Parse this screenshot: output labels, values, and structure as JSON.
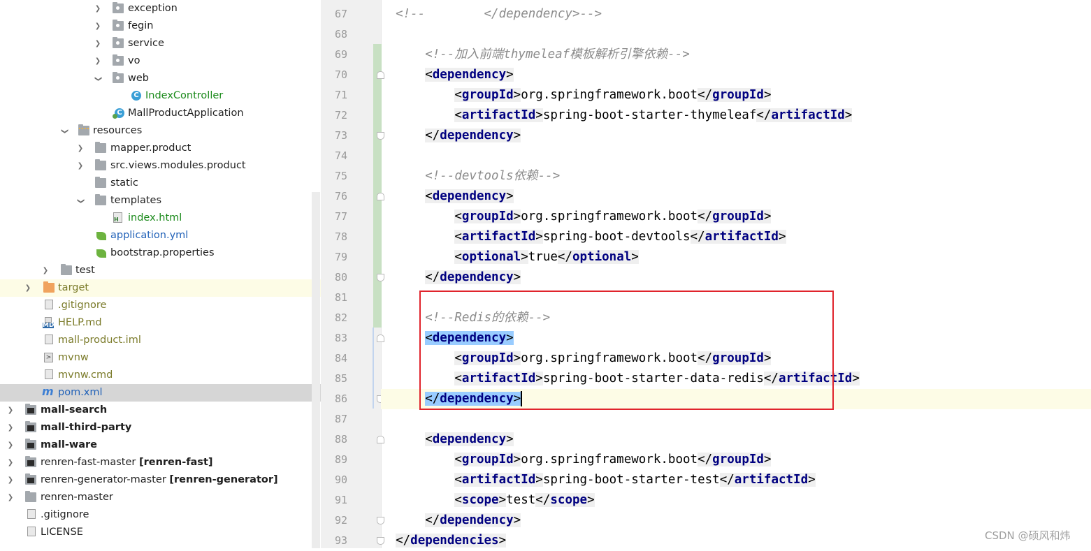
{
  "tree": {
    "items": [
      {
        "label": "exception",
        "icon": "package-folder-icon"
      },
      {
        "label": "fegin",
        "icon": "package-folder-icon"
      },
      {
        "label": "service",
        "icon": "package-folder-icon"
      },
      {
        "label": "vo",
        "icon": "package-folder-icon"
      },
      {
        "label": "web",
        "icon": "package-folder-icon"
      },
      {
        "label": "IndexController",
        "icon": "java-class-icon"
      },
      {
        "label": "MallProductApplication",
        "icon": "spring-application-icon"
      },
      {
        "label": "resources",
        "icon": "resources-folder-icon"
      },
      {
        "label": "mapper.product",
        "icon": "folder-icon"
      },
      {
        "label": "src.views.modules.product",
        "icon": "folder-icon"
      },
      {
        "label": "static",
        "icon": "folder-icon"
      },
      {
        "label": "templates",
        "icon": "folder-icon"
      },
      {
        "label": "index.html",
        "icon": "html-file-icon"
      },
      {
        "label": "application.yml",
        "icon": "spring-config-icon"
      },
      {
        "label": "bootstrap.properties",
        "icon": "spring-config-icon"
      },
      {
        "label": "test",
        "icon": "folder-icon"
      },
      {
        "label": "target",
        "icon": "excluded-folder-icon"
      },
      {
        "label": ".gitignore",
        "icon": "gitignore-file-icon"
      },
      {
        "label": "HELP.md",
        "icon": "markdown-file-icon"
      },
      {
        "label": "mall-product.iml",
        "icon": "iml-file-icon"
      },
      {
        "label": "mvnw",
        "icon": "terminal-file-icon"
      },
      {
        "label": "mvnw.cmd",
        "icon": "text-file-icon"
      },
      {
        "label": "pom.xml",
        "icon": "maven-icon"
      },
      {
        "label": "mall-search",
        "icon": "module-folder-icon"
      },
      {
        "label": "mall-third-party",
        "icon": "module-folder-icon"
      },
      {
        "label": "mall-ware",
        "icon": "module-folder-icon"
      },
      {
        "label": "renren-fast-master",
        "suffix": "[renren-fast]",
        "icon": "module-folder-icon"
      },
      {
        "label": "renren-generator-master",
        "suffix": "[renren-generator]",
        "icon": "module-folder-icon"
      },
      {
        "label": "renren-master",
        "icon": "folder-icon"
      },
      {
        "label": ".gitignore",
        "icon": "gitignore-file-icon"
      },
      {
        "label": "LICENSE",
        "icon": "text-file-icon"
      }
    ]
  },
  "editor": {
    "line_numbers": [
      "67",
      "68",
      "69",
      "70",
      "71",
      "72",
      "73",
      "74",
      "75",
      "76",
      "77",
      "78",
      "79",
      "80",
      "81",
      "82",
      "83",
      "84",
      "85",
      "86",
      "87",
      "88",
      "89",
      "90",
      "91",
      "92",
      "93"
    ],
    "lines": {
      "l67": {
        "comment": "<!--        </dependency>-->"
      },
      "l69": {
        "comment": "<!--加入前端thymeleaf模板解析引擎依赖-->"
      },
      "l70": {
        "tag": "dependency"
      },
      "l71": {
        "tag": "groupId",
        "text": "org.springframework.boot"
      },
      "l72": {
        "tag": "artifactId",
        "text": "spring-boot-starter-thymeleaf"
      },
      "l73": {
        "tag": "dependency"
      },
      "l75": {
        "comment": "<!--devtools依赖-->"
      },
      "l76": {
        "tag": "dependency"
      },
      "l77": {
        "tag": "groupId",
        "text": "org.springframework.boot"
      },
      "l78": {
        "tag": "artifactId",
        "text": "spring-boot-devtools"
      },
      "l79": {
        "tag": "optional",
        "text": "true"
      },
      "l80": {
        "tag": "dependency"
      },
      "l82": {
        "comment": "<!--Redis的依赖-->"
      },
      "l83": {
        "tag": "dependency"
      },
      "l84": {
        "tag": "groupId",
        "text": "org.springframework.boot"
      },
      "l85": {
        "tag": "artifactId",
        "text": "spring-boot-starter-data-redis"
      },
      "l86": {
        "tag": "dependency"
      },
      "l88": {
        "tag": "dependency"
      },
      "l89": {
        "tag": "groupId",
        "text": "org.springframework.boot"
      },
      "l90": {
        "tag": "artifactId",
        "text": "spring-boot-starter-test"
      },
      "l91": {
        "tag": "scope",
        "text": "test"
      },
      "l92": {
        "tag": "dependency"
      },
      "l93": {
        "tag": "dependencies"
      }
    }
  },
  "watermark": "CSDN @硕风和炜",
  "colors": {
    "tag": "#000080",
    "comment": "#8c8c8c",
    "match_highlight": "#99ccff",
    "annotation_box": "#e0242c",
    "current_line": "#fdfce6"
  }
}
